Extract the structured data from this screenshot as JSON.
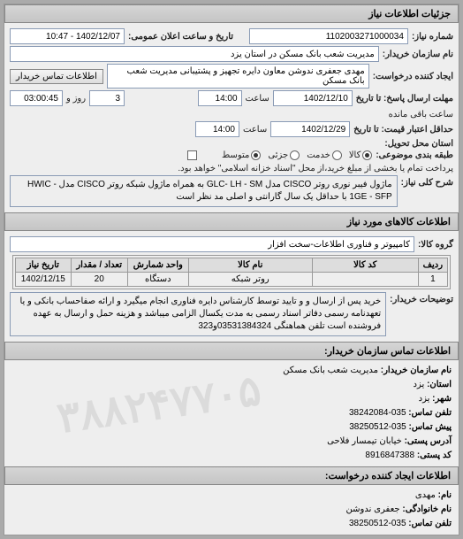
{
  "header": {
    "title": "جزئیات اطلاعات نیاز"
  },
  "top": {
    "req_no_lbl": "شماره نیاز:",
    "req_no": "1102003271000034",
    "announce_lbl": "تاریخ و ساعت اعلان عمومی:",
    "announce": "1402/12/07 - 10:47",
    "buyer_name_lbl": "نام سازمان خریدار:",
    "buyer_name": "مدیریت شعب بانک مسکن در استان یزد",
    "creator_lbl": "ایجاد کننده درخواست:",
    "creator": "مهدی  جعفری ندوشن معاون دایره تجهیز و پشتیبانی مدیریت شعب بانک مسکن",
    "contact_btn": "اطلاعات تماس خریدار",
    "deadline_reply_lbl": "مهلت ارسال پاسخ: تا تاریخ",
    "deadline_reply_date": "1402/12/10",
    "time_lbl": "ساعت",
    "deadline_reply_time": "14:00",
    "days_lbl": "روز و",
    "days": "3",
    "remain_time": "03:00:45",
    "remain_lbl": "ساعت باقی مانده",
    "validity_lbl": "حداقل اعتبار قیمت: تا تاریخ",
    "validity_date": "1402/12/29",
    "validity_time": "14:00",
    "province_lbl": "استان محل تحویل:",
    "classify_lbl": "طبقه بندی موضوعی:",
    "radios": {
      "goods": "کالا",
      "service": "خدمت",
      "part": "جزئی",
      "medium": "متوسط"
    },
    "pay_check_lbl": "پرداخت تمام یا بخشی از مبلغ خرید،از محل \"اسناد خزانه اسلامی\" خواهد بود.",
    "desc_lbl": "شرح کلی نیاز:",
    "desc": "ماژول فیبر نوری روتر CISCO مدل GLC- LH - SM به همراه ماژول شبکه روتر CISCO مدل HWIC - 1GE - SFP با حداقل یک سال گارانتی و اصلی مد نظر است"
  },
  "items_header": {
    "title": "اطلاعات کالاهای مورد نیاز"
  },
  "items": {
    "group_lbl": "گروه کالا:",
    "group_val": "کامپیوتر و فناوری اطلاعات-سخت افزار",
    "cols": {
      "row": "ردیف",
      "code": "کد کالا",
      "name": "نام کالا",
      "unit": "واحد شمارش",
      "qty": "تعداد / مقدار",
      "need_date": "تاریخ نیاز"
    },
    "rows": [
      {
        "row": "1",
        "code": "",
        "name": "روتر شبکه",
        "unit": "دستگاه",
        "qty": "20",
        "need_date": "1402/12/15"
      }
    ],
    "buyer_notes_lbl": "توضیحات خریدار:",
    "buyer_notes": "خرید پس از ارسال و و تایید توسط کارشناس دایره فناوری انجام میگیرد و ارائه صفاحساب بانکی و یا تعهدنامه رسمی دفاتر اسناد رسمی به مدت یکسال الزامی میباشد و هزینه حمل و ارسال به عهده فروشنده است تلفن هماهنگی 03531384324و323"
  },
  "contact_header": {
    "title": "اطلاعات تماس سازمان خریدار:"
  },
  "contact": {
    "org_lbl": "نام سازمان خریدار:",
    "org": "مدیریت شعب بانک مسکن",
    "province_lbl": "استان:",
    "province": "یزد",
    "city_lbl": "شهر:",
    "city": "یزد",
    "phone_lbl": "تلفن تماس:",
    "phone": "035-38242084",
    "fax_lbl": "پیش تماس:",
    "fax": "035-38250512",
    "addr_lbl": "آدرس پستی:",
    "addr": "خیابان تیمسار فلاحی",
    "postcode_lbl": "کد پستی:",
    "postcode": "8916847388"
  },
  "creator_header": {
    "title": "اطلاعات ایجاد کننده درخواست:"
  },
  "creator": {
    "name_lbl": "نام:",
    "name": "مهدی",
    "family_lbl": "نام خانوادگی:",
    "family": "جعفری ندوشن",
    "phone_lbl": "تلفن تماس:",
    "phone": "035-38250512"
  },
  "watermark": "۳۸۸۲۴۷۷۰۵"
}
